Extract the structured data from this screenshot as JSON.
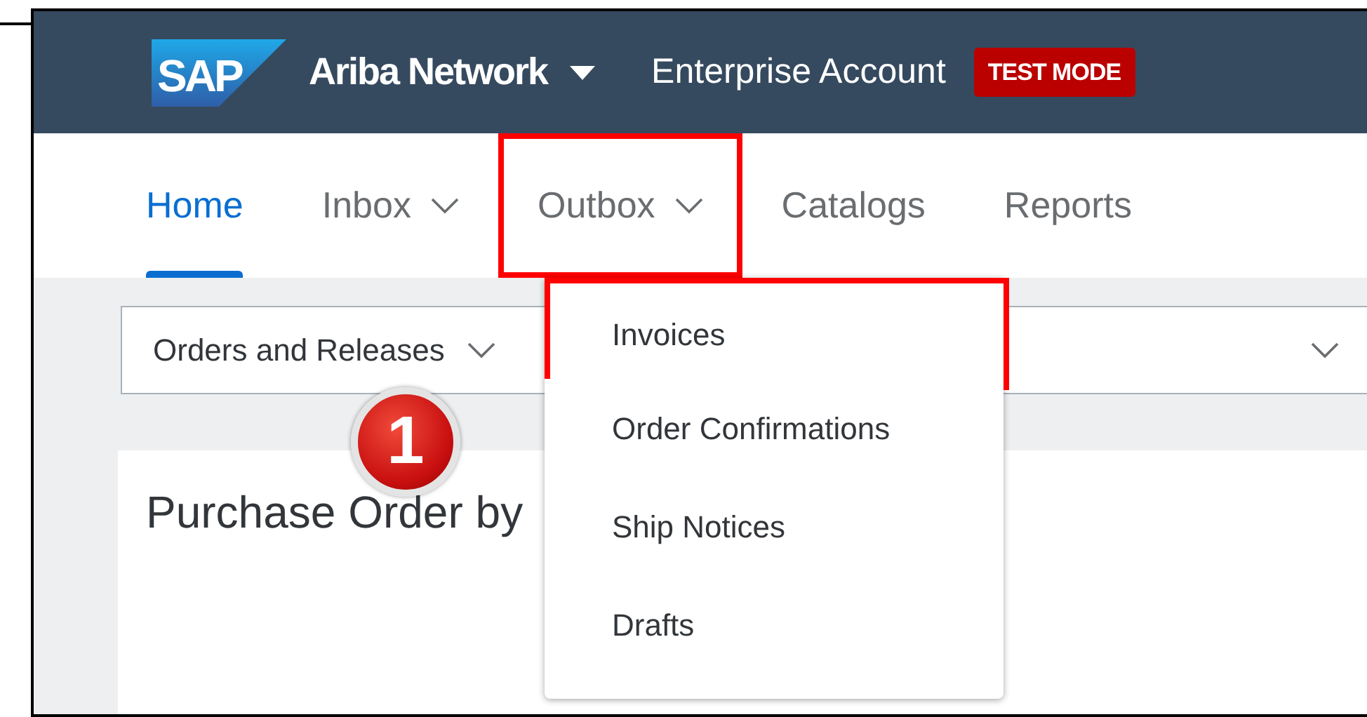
{
  "header": {
    "logo_text": "SAP",
    "product": "Ariba Network",
    "account": "Enterprise Account",
    "badge": "TEST MODE"
  },
  "tabs": [
    {
      "label": "Home",
      "selected": true,
      "has_menu": false,
      "highlighted": false
    },
    {
      "label": "Inbox",
      "selected": false,
      "has_menu": true,
      "highlighted": false
    },
    {
      "label": "Outbox",
      "selected": false,
      "has_menu": true,
      "highlighted": true
    },
    {
      "label": "Catalogs",
      "selected": false,
      "has_menu": false,
      "highlighted": false
    },
    {
      "label": "Reports",
      "selected": false,
      "has_menu": false,
      "highlighted": false
    }
  ],
  "filter": {
    "value": "Orders and Releases"
  },
  "card": {
    "title": "Purchase Order by"
  },
  "outbox_menu": [
    {
      "label": "Invoices",
      "highlighted": true
    },
    {
      "label": "Order Confirmations",
      "highlighted": false
    },
    {
      "label": "Ship Notices",
      "highlighted": false
    },
    {
      "label": "Drafts",
      "highlighted": false
    }
  ],
  "step_marker": "1"
}
